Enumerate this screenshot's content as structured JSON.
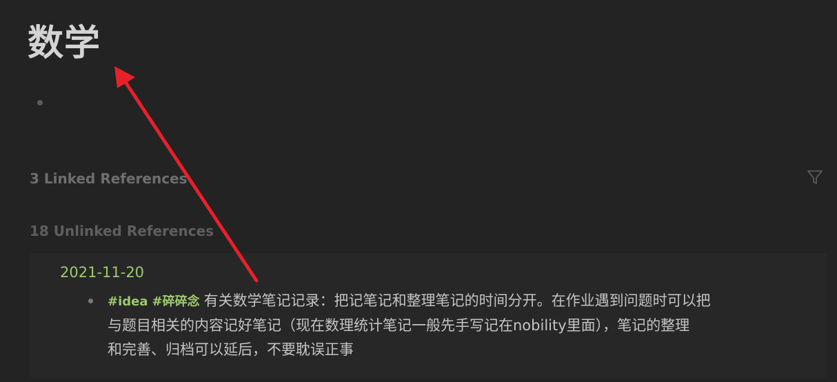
{
  "page": {
    "title": "数学"
  },
  "references": {
    "linked_label": "3 Linked References",
    "unlinked_label": "18 Unlinked References",
    "filter_icon": "filter-icon"
  },
  "unlinked_items": [
    {
      "date": "2021-11-20",
      "tags": [
        "#idea",
        "#碎碎念"
      ],
      "text_line1": "有关数学笔记记录：把记笔记和整理笔记的时间分开。在作业遇到问题时可以把",
      "text_line2": "与题目相关的内容记好笔记（现在数理统计笔记一般先手写记在nobility里面），笔记的整理",
      "text_line3": "和完善、归档可以延后，不要耽误正事"
    }
  ],
  "colors": {
    "background": "#232323",
    "title": "#d4d4d4",
    "accent_green": "#9fca6e",
    "annotation_arrow": "#e8202a"
  }
}
